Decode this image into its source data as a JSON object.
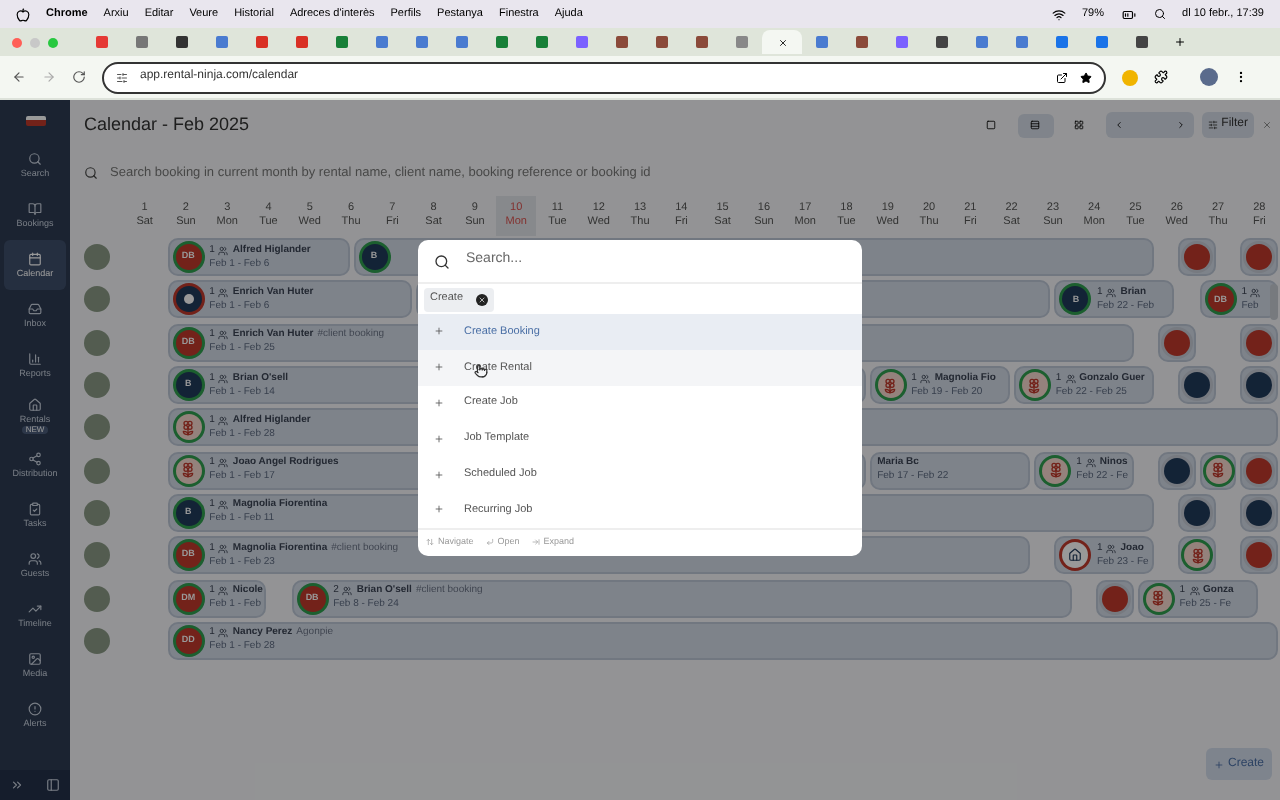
{
  "menu_bar": {
    "app": "Chrome",
    "items": [
      "Arxiu",
      "Editar",
      "Veure",
      "Historial",
      "Adreces d'interès",
      "Perfils",
      "Pestanya",
      "Finestra",
      "Ajuda"
    ],
    "battery": "79%",
    "clock": "dl 10 febr., 17:39"
  },
  "browser": {
    "url": "app.rental-ninja.com/calendar"
  },
  "sidebar": {
    "items": [
      {
        "label": "Search",
        "selected": false
      },
      {
        "label": "Bookings",
        "selected": false
      },
      {
        "label": "Calendar",
        "selected": true
      },
      {
        "label": "Inbox",
        "selected": false
      },
      {
        "label": "Reports",
        "selected": false
      },
      {
        "label": "Rentals",
        "badge": "NEW",
        "selected": false
      },
      {
        "label": "Distribution",
        "selected": false
      },
      {
        "label": "Tasks",
        "selected": false
      },
      {
        "label": "Guests",
        "selected": false
      },
      {
        "label": "Timeline",
        "selected": false
      },
      {
        "label": "Media",
        "selected": false
      },
      {
        "label": "Alerts",
        "selected": false
      }
    ]
  },
  "calendar": {
    "title": "Calendar - Feb 2025",
    "search_placeholder": "Search booking in current month by rental name, client name, booking reference or booking id",
    "filter": "Filter",
    "days": [
      {
        "num": "1",
        "dow": "Sat",
        "today": false
      },
      {
        "num": "2",
        "dow": "Sun",
        "today": false
      },
      {
        "num": "3",
        "dow": "Mon",
        "today": false
      },
      {
        "num": "4",
        "dow": "Tue",
        "today": false
      },
      {
        "num": "5",
        "dow": "Wed",
        "today": false
      },
      {
        "num": "6",
        "dow": "Thu",
        "today": false
      },
      {
        "num": "7",
        "dow": "Fri",
        "today": false
      },
      {
        "num": "8",
        "dow": "Sat",
        "today": false
      },
      {
        "num": "9",
        "dow": "Sun",
        "today": false
      },
      {
        "num": "10",
        "dow": "Mon",
        "today": true
      },
      {
        "num": "11",
        "dow": "Tue",
        "today": false
      },
      {
        "num": "12",
        "dow": "Wed",
        "today": false
      },
      {
        "num": "13",
        "dow": "Thu",
        "today": false
      },
      {
        "num": "14",
        "dow": "Fri",
        "today": false
      },
      {
        "num": "15",
        "dow": "Sat",
        "today": false
      },
      {
        "num": "16",
        "dow": "Sun",
        "today": false
      },
      {
        "num": "17",
        "dow": "Mon",
        "today": false
      },
      {
        "num": "18",
        "dow": "Tue",
        "today": false
      },
      {
        "num": "19",
        "dow": "Wed",
        "today": false
      },
      {
        "num": "20",
        "dow": "Thu",
        "today": false
      },
      {
        "num": "21",
        "dow": "Fri",
        "today": false
      },
      {
        "num": "22",
        "dow": "Sat",
        "today": false
      },
      {
        "num": "23",
        "dow": "Sun",
        "today": false
      },
      {
        "num": "24",
        "dow": "Mon",
        "today": false
      },
      {
        "num": "25",
        "dow": "Tue",
        "today": false
      },
      {
        "num": "26",
        "dow": "Wed",
        "today": false
      },
      {
        "num": "27",
        "dow": "Thu",
        "today": false
      },
      {
        "num": "28",
        "dow": "Fri",
        "today": false
      }
    ],
    "rows": [
      {
        "bookings": [
          {
            "kind": "initials",
            "initials": "DB",
            "color": "#73221a",
            "guests": "1",
            "name": "Alfred Higlander",
            "dates": "Feb 1 - Feb 6"
          },
          {
            "kind": "initials",
            "initials": "B",
            "color": "#132336"
          },
          {
            "kind": "dot",
            "color": "#73221a"
          },
          {
            "kind": "dot",
            "color": "#73221a"
          }
        ]
      },
      {
        "bookings": [
          {
            "kind": "emblem",
            "color": "#132336",
            "guests": "1",
            "name": "Enrich Van Huter",
            "dates": "Feb 1 - Feb 6"
          },
          {
            "kind": "blank"
          },
          {
            "kind": "initials",
            "initials": "B",
            "color": "#132336",
            "guests": "1",
            "name": "Brian",
            "dates": "Feb 22 - Feb"
          },
          {
            "kind": "initials",
            "initials": "DB",
            "color": "#73221a",
            "guests": "1",
            "dates": "Feb"
          }
        ]
      },
      {
        "bookings": [
          {
            "kind": "initials",
            "initials": "DB",
            "color": "#73221a",
            "guests": "1",
            "name": "Enrich Van Huter",
            "note": "#client booking",
            "dates": "Feb 1 - Feb 25"
          },
          {
            "kind": "dot",
            "color": "#73221a"
          },
          {
            "kind": "dot",
            "color": "#73221a"
          }
        ]
      },
      {
        "bookings": [
          {
            "kind": "initials",
            "initials": "B",
            "color": "#132336",
            "guests": "1",
            "name": "Brian O'sell",
            "dates": "Feb 1 - Feb 14"
          },
          {
            "kind": "flower",
            "guests": "1",
            "name": "Magnolia Fio",
            "dates": "Feb 19 - Feb 20"
          },
          {
            "kind": "flower",
            "guests": "1",
            "name": "Gonzalo Guer",
            "dates": "Feb 22 - Feb 25"
          },
          {
            "kind": "dot",
            "color": "#132336"
          },
          {
            "kind": "dot",
            "color": "#132336"
          }
        ]
      },
      {
        "bookings": [
          {
            "kind": "flower",
            "guests": "1",
            "name": "Alfred Higlander",
            "dates": "Feb 1 - Feb 28"
          }
        ]
      },
      {
        "bookings": [
          {
            "kind": "flower",
            "guests": "1",
            "name": "Joao Angel Rodrigues",
            "dates": "Feb 1 - Feb 17"
          },
          {
            "kind": "blank",
            "name": "Maria Bc",
            "dates": "Feb 17 - Feb 22"
          },
          {
            "kind": "flower",
            "guests": "1",
            "name": "Ninos",
            "dates": "Feb 22 - Fe"
          },
          {
            "kind": "dot",
            "color": "#132336"
          },
          {
            "kind": "flower"
          },
          {
            "kind": "dot",
            "color": "#73221a"
          }
        ]
      },
      {
        "bookings": [
          {
            "kind": "initials",
            "initials": "B",
            "color": "#132336",
            "guests": "1",
            "name": "Magnolia Fiorentina",
            "dates": "Feb 1 - Feb 11"
          },
          {
            "kind": "dot",
            "color": "#132336"
          },
          {
            "kind": "dot",
            "color": "#132336"
          }
        ]
      },
      {
        "bookings": [
          {
            "kind": "initials",
            "initials": "DB",
            "color": "#73221a",
            "guests": "1",
            "name": "Magnolia Fiorentina",
            "note": "#client booking",
            "dates": "Feb 1 - Feb 23"
          },
          {
            "kind": "house",
            "guests": "1",
            "name": "Joao",
            "dates": "Feb 23 - Fe"
          },
          {
            "kind": "flower"
          },
          {
            "kind": "dot",
            "color": "#73221a"
          }
        ]
      },
      {
        "bookings": [
          {
            "kind": "initials",
            "initials": "DM",
            "color": "#73221a",
            "guests": "1",
            "name": "Nicole",
            "dates": "Feb 1 - Feb"
          },
          {
            "kind": "initials",
            "initials": "DB",
            "color": "#73221a",
            "guests": "2",
            "name": "Brian O'sell",
            "note": "#client booking",
            "dates": "Feb 8 - Feb 24"
          },
          {
            "kind": "dot",
            "color": "#73221a"
          },
          {
            "kind": "flower",
            "guests": "1",
            "name": "Gonza",
            "dates": "Feb 25 - Fe"
          }
        ]
      },
      {
        "bookings": [
          {
            "kind": "initials",
            "initials": "DD",
            "color": "#73221a",
            "guests": "1",
            "name": "Nancy Perez",
            "note": "Agonpie",
            "dates": "Feb 1 - Feb 28"
          }
        ]
      }
    ]
  },
  "command_palette": {
    "placeholder": "Search...",
    "chip": "Create",
    "items": [
      {
        "label": "Create Booking",
        "selected": true,
        "hovered": false
      },
      {
        "label": "Create Rental",
        "selected": false,
        "hovered": true
      },
      {
        "label": "Create Job",
        "selected": false,
        "hovered": false
      },
      {
        "label": "Job Template",
        "selected": false,
        "hovered": false
      },
      {
        "label": "Scheduled Job",
        "selected": false,
        "hovered": false
      },
      {
        "label": "Recurring Job",
        "selected": false,
        "hovered": false
      }
    ],
    "hints": [
      "Navigate",
      "Open",
      "Expand"
    ]
  },
  "create_button": "Create"
}
